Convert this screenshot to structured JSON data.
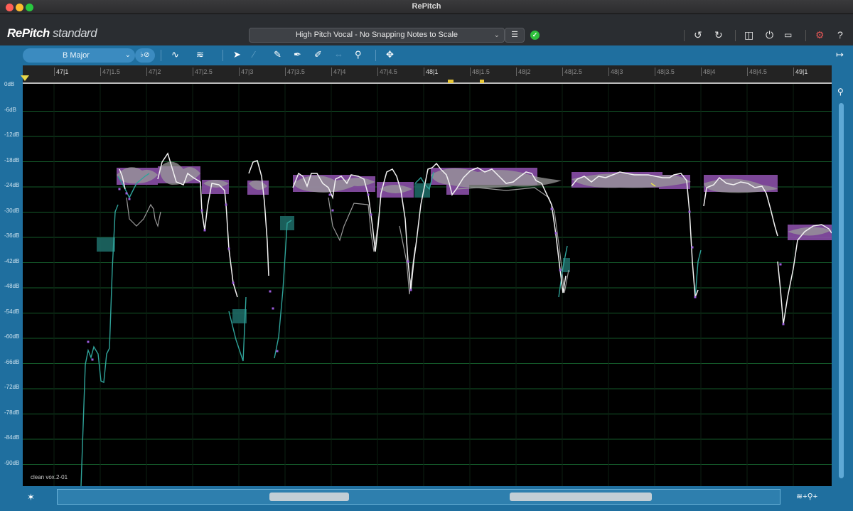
{
  "window": {
    "title": "RePitch"
  },
  "header": {
    "logo_main": "RePitch",
    "logo_sub": " standard",
    "preset_value": "High Pitch Vocal - No Snapping Notes to Scale",
    "status_icon": "check-circle-icon"
  },
  "toolbar": {
    "key_value": "B Major"
  },
  "ruler": {
    "ticks": [
      "47|1",
      "47|1.5",
      "47|2",
      "47|2.5",
      "47|3",
      "47|3.5",
      "47|4",
      "47|4.5",
      "48|1",
      "48|1.5",
      "48|2",
      "48|2.5",
      "48|3",
      "48|3.5",
      "48|4",
      "48|4.5",
      "49|1"
    ]
  },
  "db_labels": [
    "0dB",
    "-6dB",
    "-12dB",
    "-18dB",
    "-24dB",
    "-30dB",
    "-36dB",
    "-42dB",
    "-48dB",
    "-54dB",
    "-60dB",
    "-66dB",
    "-72dB",
    "-78dB",
    "-84dB",
    "-90dB"
  ],
  "track": {
    "name": "clean vox.2-01"
  },
  "colors": {
    "accent": "#1f6f9f",
    "note": "#8a4fa8",
    "pitch_unvoiced": "#2fa39a",
    "pitch_line": "#ffffff"
  }
}
